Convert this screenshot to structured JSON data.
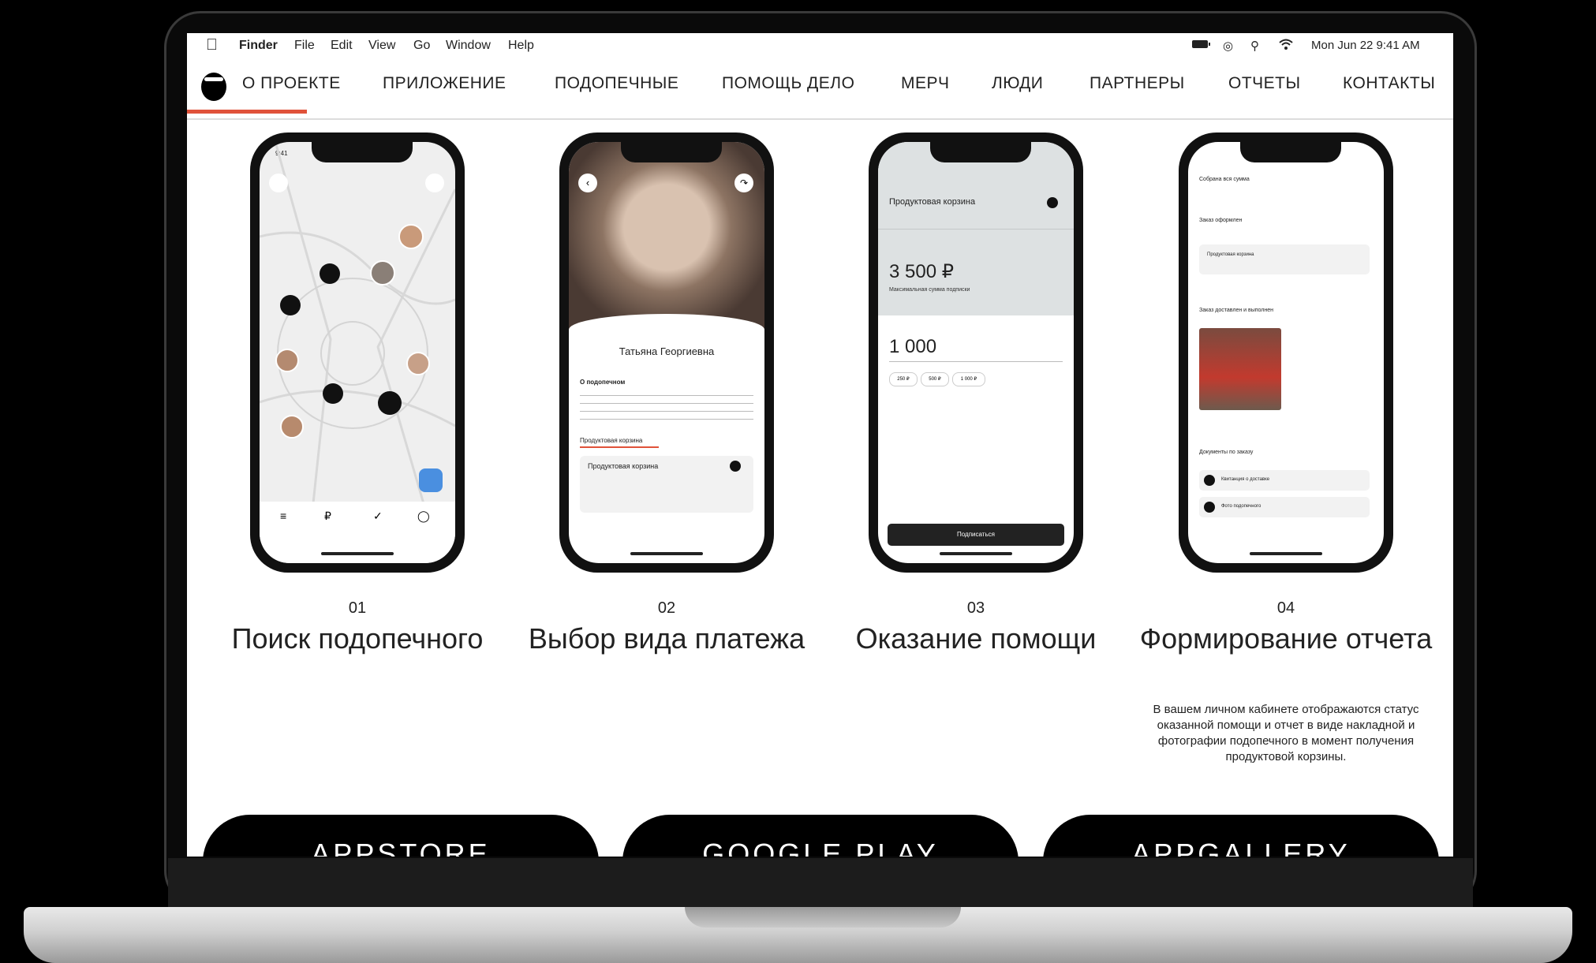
{
  "menubar": {
    "app": "Finder",
    "items": [
      "File",
      "Edit",
      "View",
      "Go",
      "Window",
      "Help"
    ],
    "datetime": "Mon Jun 22  9:41 AM"
  },
  "nav": {
    "links": [
      "О ПРОЕКТЕ",
      "ПРИЛОЖЕНИЕ",
      "ПОДОПЕЧНЫЕ",
      "ПОМОЩЬ ДЕЛО",
      "МЕРЧ",
      "ЛЮДИ",
      "ПАРТНЕРЫ",
      "ОТЧЕТЫ",
      "КОНТАКТЫ"
    ],
    "accent": "#e0523a"
  },
  "phones": {
    "time": "9:41",
    "profile": {
      "name": "Татьяна Георгиевна",
      "section": "О подопечном",
      "tab": "Продуктовая корзина",
      "card_title": "Продуктовая корзина"
    },
    "payment": {
      "title": "Продуктовая корзина",
      "amount": "3 500 ₽",
      "amount_label": "Максимальная сумма подписки",
      "input_value": "1 000",
      "chips": [
        "250 ₽",
        "500 ₽",
        "1 000 ₽"
      ],
      "button": "Подписаться"
    },
    "report": {
      "rows": [
        "Собрана вся сумма",
        "Заказ оформлен",
        "Заказ доставлен и выполнен",
        "Документы по заказу"
      ],
      "item": "Продуктовая корзина",
      "docs": [
        "Квитанция о доставке",
        "Фото подопечного"
      ]
    }
  },
  "steps": [
    {
      "num": "01",
      "title": "Поиск подопечного"
    },
    {
      "num": "02",
      "title": "Выбор вида платежа"
    },
    {
      "num": "03",
      "title": "Оказание помощи"
    },
    {
      "num": "04",
      "title": "Формирование отчета",
      "desc": "В вашем личном кабинете отображаются статус оказанной помощи и отчет в виде накладной и фотографии подопечного в момент получения продуктовой корзины."
    }
  ],
  "stores": [
    "APPSTORE",
    "GOOGLE PLAY",
    "APPGALLERY"
  ]
}
